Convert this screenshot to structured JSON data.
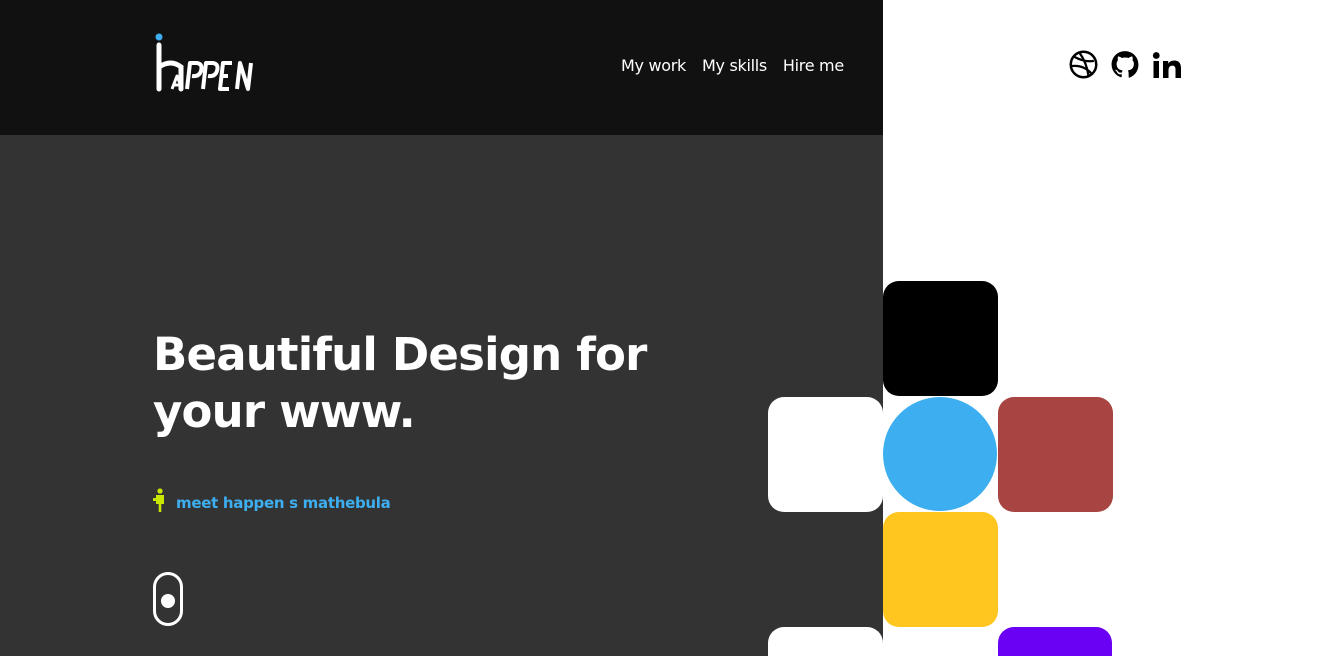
{
  "brand": {
    "logo_text": "hAPPEN"
  },
  "nav": {
    "items": [
      {
        "label": "My work"
      },
      {
        "label": "My skills"
      },
      {
        "label": "Hire me"
      }
    ]
  },
  "social": {
    "icons": [
      "dribbble-icon",
      "github-icon",
      "linkedin-icon"
    ],
    "linkedin_text": "in"
  },
  "hero": {
    "title_line1": "Beautiful Design for",
    "title_line2": "your www.",
    "meet_link": "meet happen s mathebula"
  },
  "colors": {
    "header_bg": "#111111",
    "panel_bg": "#333333",
    "accent_blue": "#3daeef",
    "accent_yellow_green": "#c8e600",
    "tile_black": "#000000",
    "tile_white": "#ffffff",
    "tile_blue": "#3daeef",
    "tile_red": "#a84442",
    "tile_yellow": "#ffc61f",
    "tile_purple": "#6a00f4"
  }
}
